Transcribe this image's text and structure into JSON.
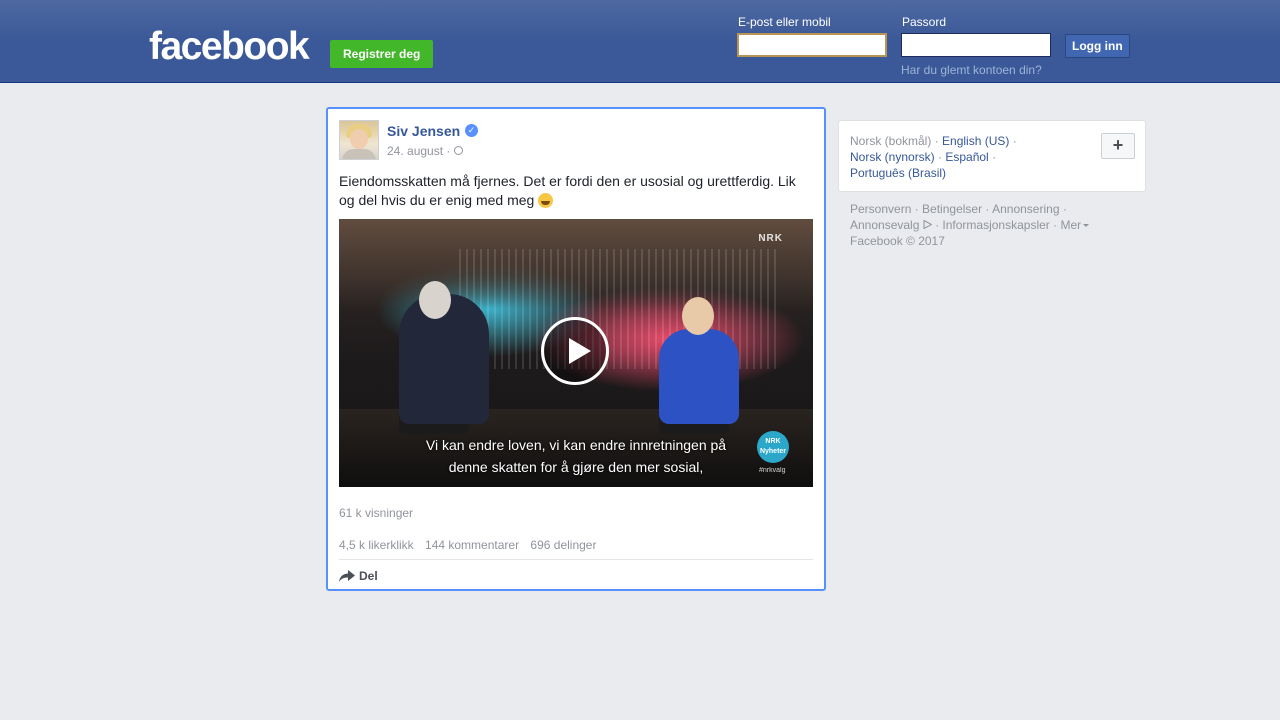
{
  "header": {
    "logo": "facebook",
    "register_label": "Registrer deg",
    "email_label": "E-post eller mobil",
    "email_value": "",
    "password_label": "Passord",
    "password_value": "",
    "login_label": "Logg inn",
    "forgot_label": "Har du glemt kontoen din?"
  },
  "post": {
    "author": "Siv Jensen",
    "date": "24. august ·",
    "text": "Eiendomsskatten må fjernes. Det er fordi den er usosial og urettferdig. Lik og del hvis du er enig med meg",
    "video": {
      "watermark": "NRK",
      "subtitle_line1": "Vi kan endre loven, vi kan endre innretningen på",
      "subtitle_line2": "denne skatten for å gjøre den mer sosial,",
      "badge_line1": "NRK",
      "badge_line2": "Nyheter",
      "tag": "#nrkvalg"
    },
    "views": "61 k visninger",
    "likes": "4,5 k likerklikk",
    "comments": "144 kommentarer",
    "shares": "696 delinger",
    "share_label": "Del"
  },
  "languages": {
    "current": "Norsk (bokmål)",
    "items": [
      "English (US)",
      "Norsk (nynorsk)",
      "Español",
      "Português (Brasil)"
    ],
    "plus_label": "+"
  },
  "footer": {
    "links": [
      "Personvern",
      "Betingelser",
      "Annonsering",
      "Annonsevalg",
      "Informasjonskapsler",
      "Mer"
    ],
    "copyright": "Facebook © 2017"
  },
  "colors": {
    "topbar": "#3b5998",
    "register_green": "#42b72a",
    "link_blue": "#365899",
    "focus_border": "#5890ff"
  }
}
